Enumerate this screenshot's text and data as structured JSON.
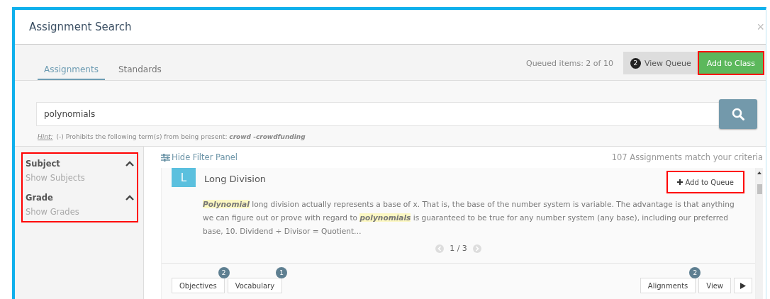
{
  "window": {
    "title": "Assignment Search",
    "close": "×"
  },
  "tabs": [
    {
      "label": "Assignments",
      "selected": true
    },
    {
      "label": "Standards",
      "selected": false
    }
  ],
  "queue": {
    "status": "Queued items: 2 of 10",
    "count": "2",
    "view_label": "View Queue",
    "add_label": "Add to Class",
    "add_annotated": true
  },
  "search": {
    "value": "polynomials",
    "hint_label": "Hint:",
    "hint_text": "(-) Prohibits the following term(s) from being present: ",
    "hint_example": "crowd -crowdfunding"
  },
  "filters": {
    "annotated": true,
    "groups": [
      {
        "title": "Subject",
        "link": "Show Subjects",
        "expanded": true
      },
      {
        "title": "Grade",
        "link": "Show Grades",
        "expanded": true
      }
    ]
  },
  "results": {
    "toggle": "Hide Filter Panel",
    "count": "107 Assignments match your criteria",
    "item": {
      "initial": "L",
      "title": "Long Division",
      "add_label": "Add to Queue",
      "add_annotated": true,
      "snippet": "*Polynomial* long division actually represents a base of x. That is, the base of the number system is variable. The advantage is that anything we can figure out or prove with regard to *polynomials* is guaranteed to be true for any number system (any base), including our preferred base, 10. Dividend ÷ Divisor = Quotient…",
      "pager": "1 / 3",
      "left_tabs": [
        {
          "label": "Objectives",
          "badge": "2"
        },
        {
          "label": "Vocabulary",
          "badge": "1"
        }
      ],
      "right_tabs": [
        {
          "label": "Alignments",
          "badge": "2"
        },
        {
          "label": "View"
        }
      ]
    }
  }
}
